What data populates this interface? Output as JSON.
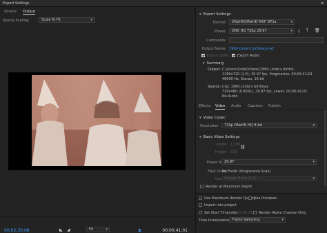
{
  "window": {
    "title": "Export Settings",
    "close_glyph": "✕"
  },
  "left": {
    "tabs": [
      {
        "label": "Source"
      },
      {
        "label": "Output"
      }
    ],
    "source_scaling_label": "Source Scaling:",
    "source_scaling_value": "Scale To Fit",
    "timecode_current": "00;02;30;08",
    "timecode_end": "00;00;41;01",
    "fit_value": "Fit"
  },
  "export_settings": {
    "header": "Export Settings",
    "format_label": "Format:",
    "format_value": "DNxHR/DNxHD MXF OP1a",
    "preset_label": "Preset:",
    "preset_value": "DNX HQ 720p 29.97",
    "comments_label": "Comments:",
    "comments_value": "",
    "output_name_label": "Output Name:",
    "output_name_value": "1969 Linda's birthday.mxf",
    "export_video_label": "Export Video",
    "export_video_checked": true,
    "export_audio_label": "Export Audio",
    "export_audio_checked": true
  },
  "summary": {
    "header": "Summary",
    "output_label": "Output:",
    "output_lines": [
      "C:\\Users\\linda\\Videos\\1969 Linda's birthd...",
      "1280x720 (1.0), 29.97 fps, Progressive, 00;00;41;01",
      "48000 Hz, Stereo, 16 bit"
    ],
    "source_label": "Source:",
    "source_lines": [
      "Clip, 1969 Linda's birthday",
      "720x480 (0.9091), 29.97 fps, Lower, 00;00;41;01",
      "No Audio"
    ]
  },
  "mid_tabs": [
    {
      "label": "Effects"
    },
    {
      "label": "Video"
    },
    {
      "label": "Audio"
    },
    {
      "label": "Captions"
    },
    {
      "label": "Publish"
    }
  ],
  "video_codec": {
    "header": "Video Codec",
    "resolution_label": "Resolution:",
    "resolution_value": "720p DNxHD HQ 8-bit"
  },
  "basic_video": {
    "header": "Basic Video Settings",
    "width_label": "Width:",
    "width_value": "1,280",
    "height_label": "Height:",
    "height_value": "720",
    "frame_rate_label": "Frame Rate:",
    "frame_rate_value": "29.97",
    "field_order_label": "Field Order:",
    "field_order_value": "No Fields (Progressive Scan)",
    "aspect_label": "Aspect:",
    "aspect_value": "Square Pixels (1.0)",
    "max_depth_label": "Render at Maximum Depth"
  },
  "bottom": {
    "use_max_render_label": "Use Maximum Render Quality",
    "use_previews_label": "Use Previews",
    "import_project_label": "Import into project",
    "set_start_tc_label": "Set Start Timecode",
    "set_start_tc_value": "00;00;00;00",
    "render_alpha_label": "Render Alpha Channel Only",
    "time_interp_label": "Time Interpolation:",
    "time_interp_value": "Frame Sampling"
  },
  "colors": {
    "accent": "#3a9bff",
    "panel": "#262626",
    "background": "#1f1f1f"
  }
}
